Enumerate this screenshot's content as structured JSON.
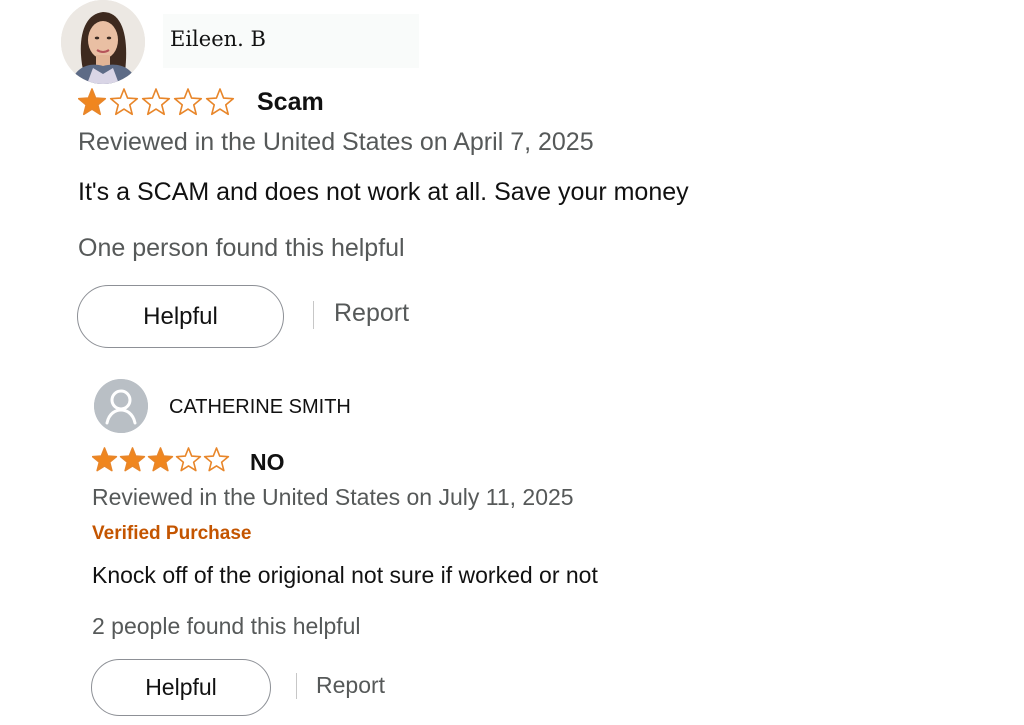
{
  "reviews": [
    {
      "reviewer_name": "Eileen. B",
      "avatar_icon": "reviewer-photo",
      "rating": 1,
      "max_rating": 5,
      "title": "Scam",
      "date_line": "Reviewed in the United States on April 7, 2025",
      "body": "It's a SCAM and does not work at all. Save your money",
      "helpful_count_text": "One person found this helpful",
      "helpful_label": "Helpful",
      "report_label": "Report"
    },
    {
      "reviewer_name": "CATHERINE SMITH",
      "avatar_icon": "default-user-icon",
      "rating": 3,
      "max_rating": 5,
      "title": "NO",
      "date_line": "Reviewed in the United States on July 11, 2025",
      "verified_badge": "Verified Purchase",
      "body": "Knock off of the origional not sure if worked or not",
      "helpful_count_text": "2 people found this helpful",
      "helpful_label": "Helpful",
      "report_label": "Report"
    }
  ],
  "colors": {
    "star_fill": "#f0861e",
    "star_outline": "#e8862a",
    "verified": "#c45500",
    "secondary_text": "#565959"
  }
}
